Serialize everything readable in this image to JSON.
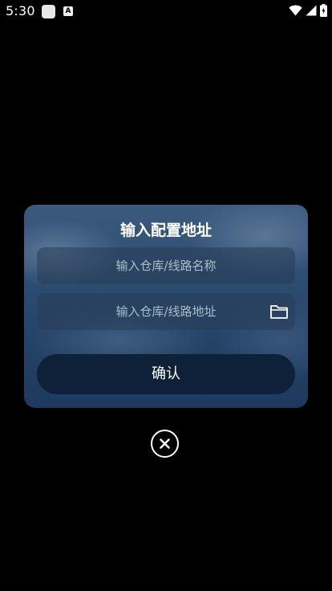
{
  "status_bar": {
    "time": "5:30",
    "app_icon_a": "A",
    "icons": [
      "notification-app-icon",
      "a-icon",
      "wifi-icon",
      "signal-icon",
      "battery-icon"
    ]
  },
  "dialog": {
    "title": "输入配置地址",
    "name_field": {
      "placeholder": "输入仓库/线路名称",
      "value": ""
    },
    "address_field": {
      "placeholder": "输入仓库/线路地址",
      "value": "",
      "icon": "folder-icon"
    },
    "confirm_label": "确认"
  },
  "close": {
    "icon": "close-icon"
  },
  "colors": {
    "background": "#000000",
    "dialog_top": "#3b5a7d",
    "dialog_bottom": "#1d3a5e",
    "confirm_button": "#0f2139",
    "text": "#ffffff"
  }
}
